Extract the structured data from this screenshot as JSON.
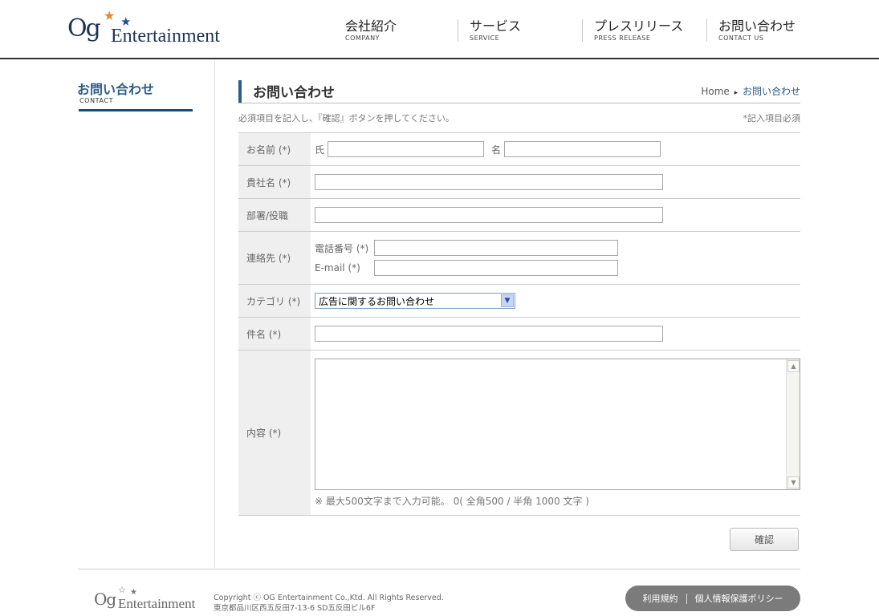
{
  "header": {
    "logo": {
      "og": "Og",
      "entertainment": "Entertainment"
    },
    "nav": [
      {
        "jp": "会社紹介",
        "en": "COMPANY"
      },
      {
        "jp": "サービス",
        "en": "SERVICE"
      },
      {
        "jp": "プレスリリース",
        "en": "PRESS RELEASE"
      },
      {
        "jp": "お問い合わせ",
        "en": "CONTACT US"
      }
    ]
  },
  "sidebar": {
    "title": "お問い合わせ",
    "subtitle": "CONTACT"
  },
  "main": {
    "title": "お問い合わせ",
    "breadcrumb": {
      "home": "Home",
      "separator": "▸",
      "current": "お問い合わせ"
    },
    "instruction": "必須項目を記入し、『確認』ボタンを押してください。",
    "required_note": "*記入項目必須",
    "form": {
      "name": {
        "label": "お名前 (*)",
        "last_label": "氏",
        "first_label": "名"
      },
      "company": {
        "label": "貴社名 (*)"
      },
      "department": {
        "label": "部署/役職"
      },
      "contact": {
        "label": "連絡先 (*)",
        "phone_label": "電話番号 (*)",
        "email_label": "E-mail (*)"
      },
      "category": {
        "label": "カテゴリ (*)",
        "selected": "広告に関するお問い合わせ"
      },
      "subject": {
        "label": "件名 (*)"
      },
      "content": {
        "label": "内容 (*)",
        "note": "※ 最大500文字まで入力可能。 0( 全角500 / 半角 1000 文字 )"
      }
    },
    "confirm_label": "確認"
  },
  "footer": {
    "logo": {
      "og": "Og",
      "entertainment": "Entertainment"
    },
    "copyright": "Copyright ⓒ OG Entertainment Co.,Ktd. All Rights Reserved.",
    "address": "東京都品川区西五反田7-13-6 SD五反田ビル6F",
    "links": {
      "terms": "利用規約",
      "privacy": "個人情報保護ポリシー"
    }
  },
  "colors": {
    "accent": "#2a5c8a",
    "label_bg": "#efefef",
    "footer_pill": "#7b7b7b"
  }
}
